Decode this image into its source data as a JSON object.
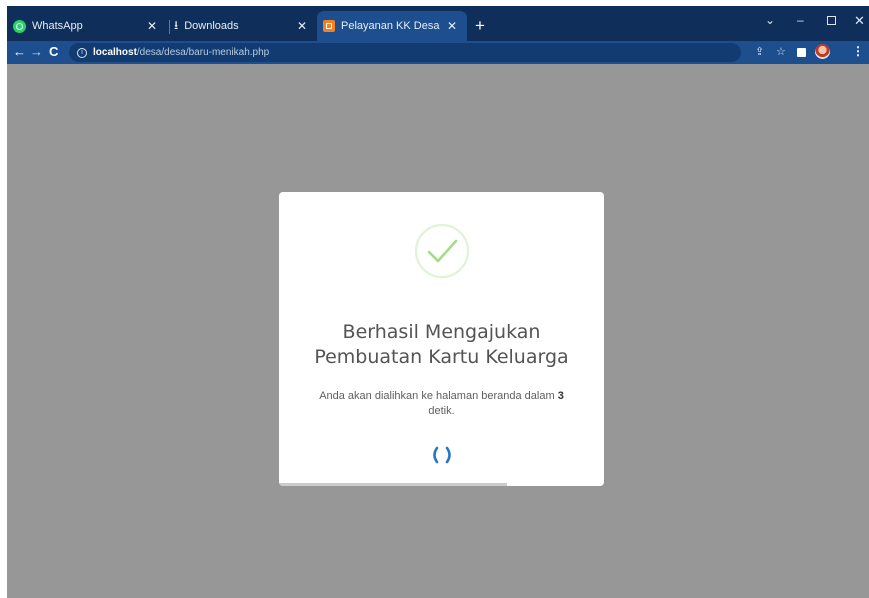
{
  "browser": {
    "tabs": [
      {
        "label": "WhatsApp",
        "icon": "whatsapp-icon"
      },
      {
        "label": "Downloads",
        "icon": "download-icon"
      },
      {
        "label": "Pelayanan KK Desa",
        "icon": "site-favicon",
        "active": true
      }
    ],
    "address": {
      "host": "localhost",
      "path": "/desa/desa/baru-menikah.php"
    }
  },
  "dialog": {
    "title_line1": "Berhasil Mengajukan",
    "title_line2": "Pembuatan Kartu Keluarga",
    "message_before": "Anda akan dialihkan ke halaman beranda dalam ",
    "countdown": "3",
    "message_after": "detik.",
    "timer_progress": 0.7,
    "success_color": "#a5dc86",
    "spinner_color": "#2778c4"
  }
}
